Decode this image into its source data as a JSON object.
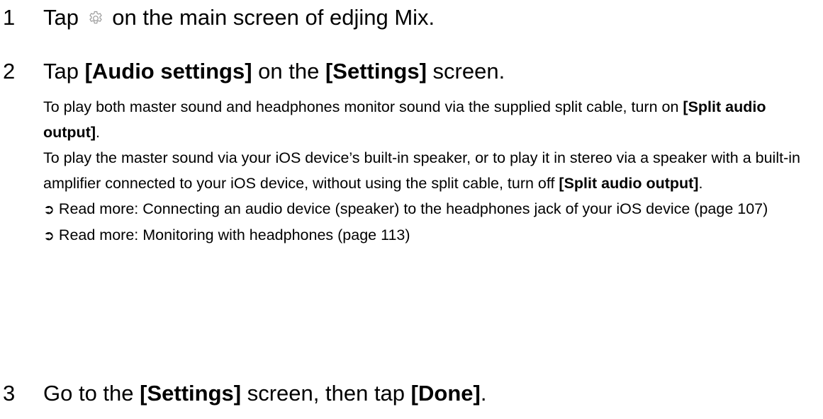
{
  "steps": [
    {
      "number": "1",
      "heading_before": "Tap",
      "icon": "gear-icon",
      "heading_after": "on the main screen of edjing Mix."
    },
    {
      "number": "2",
      "heading_1": "Tap",
      "heading_2": "[Audio settings]",
      "heading_3": "on the",
      "heading_4": "[Settings]",
      "heading_5": "screen.",
      "para1_a": "To play both master sound and headphones monitor sound via the supplied split cable, turn on",
      "para1_b": "[Split audio output]",
      "para1_c": ".",
      "para2_a": "To play the master sound via your iOS device’s built-in speaker, or to play it in stereo via a speaker with a built-in amplifier connected to your iOS device, without using the split cable, turn off",
      "para2_b": "[Split audio output]",
      "para2_c": ".",
      "link1_arrow": "➲",
      "link1_text": "Read more: Connecting an audio device (speaker) to the headphones jack of your iOS device (page 107)",
      "link2_arrow": "➲",
      "link2_text": "Read more: Monitoring with headphones (page 113)"
    },
    {
      "number": "3",
      "heading_1": "Go to the",
      "heading_2": "[Settings]",
      "heading_3": "screen, then tap",
      "heading_4": "[Done]",
      "heading_5": "."
    }
  ]
}
